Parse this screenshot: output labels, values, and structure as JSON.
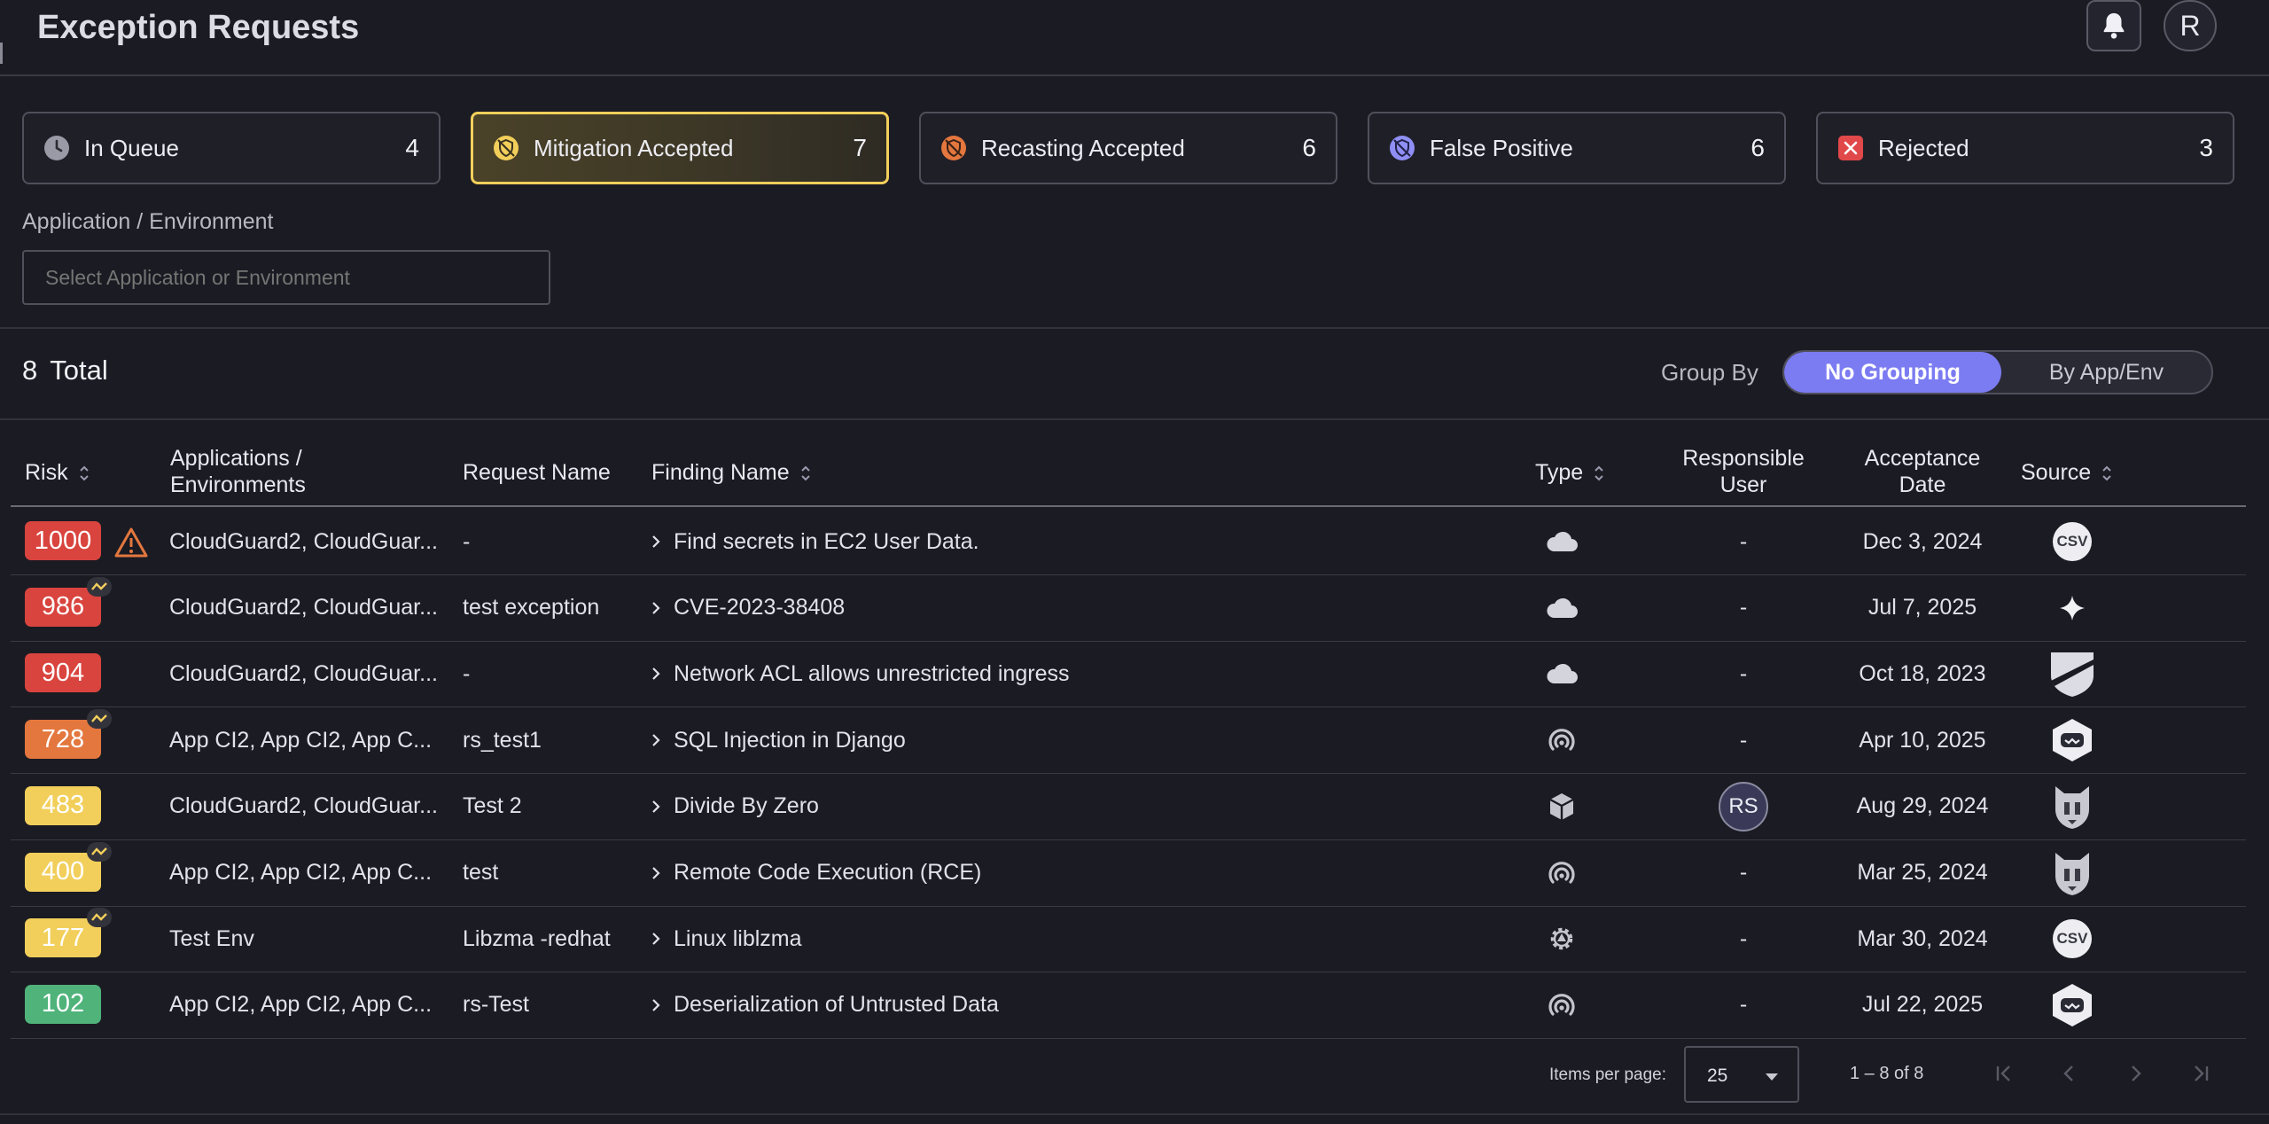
{
  "header": {
    "title": "Exception Requests",
    "avatar_letter": "R"
  },
  "status_cards": [
    {
      "label": "In Queue",
      "count": "4",
      "icon": "clock-icon"
    },
    {
      "label": "Mitigation Accepted",
      "count": "7",
      "icon": "mitigation-shield-icon"
    },
    {
      "label": "Recasting Accepted",
      "count": "6",
      "icon": "recast-shield-icon"
    },
    {
      "label": "False Positive",
      "count": "6",
      "icon": "false-positive-shield-icon"
    },
    {
      "label": "Rejected",
      "count": "3",
      "icon": "x-icon"
    }
  ],
  "filter": {
    "label": "Application / Environment",
    "placeholder": "Select Application or Environment"
  },
  "summary": {
    "count": "8",
    "label": "Total"
  },
  "group_by": {
    "label": "Group By",
    "options": [
      "No Grouping",
      "By App/Env"
    ],
    "selected": "No Grouping"
  },
  "table": {
    "headers": {
      "risk": "Risk",
      "apps_line1": "Applications /",
      "apps_line2": "Environments",
      "request": "Request Name",
      "finding": "Finding Name",
      "type": "Type",
      "user_line1": "Responsible",
      "user_line2": "User",
      "date_line1": "Acceptance",
      "date_line2": "Date",
      "source": "Source"
    },
    "rows": [
      {
        "risk": "1000",
        "risk_color": "#d9443e",
        "warning": true,
        "trend": false,
        "apps": "CloudGuard2, CloudGuar...",
        "request": "-",
        "finding": "Find secrets in EC2 User Data.",
        "type_icon": "cloud-icon",
        "user": "-",
        "date": "Dec 3, 2024",
        "source_icon": "csv-icon",
        "source_text": "CSV"
      },
      {
        "risk": "986",
        "risk_color": "#d9443e",
        "warning": false,
        "trend": true,
        "apps": "CloudGuard2, CloudGuar...",
        "request": "test exception",
        "finding": "CVE-2023-38408",
        "type_icon": "cloud-icon",
        "user": "-",
        "date": "Jul 7, 2025",
        "source_icon": "sparkle-icon",
        "source_text": ""
      },
      {
        "risk": "904",
        "risk_color": "#d9443e",
        "warning": false,
        "trend": false,
        "apps": "CloudGuard2, CloudGuar...",
        "request": "-",
        "finding": "Network ACL allows unrestricted ingress",
        "type_icon": "cloud-icon",
        "user": "-",
        "date": "Oct 18, 2023",
        "source_icon": "shield-logo-icon",
        "source_text": ""
      },
      {
        "risk": "728",
        "risk_color": "#e3773e",
        "warning": false,
        "trend": true,
        "apps": "App CI2, App CI2, App C...",
        "request": "rs_test1",
        "finding": "SQL Injection in Django",
        "type_icon": "signal-icon",
        "user": "-",
        "date": "Apr 10, 2025",
        "source_icon": "hexagon-bot-icon",
        "source_text": ""
      },
      {
        "risk": "483",
        "risk_color": "#f2cf5b",
        "warning": false,
        "trend": false,
        "apps": "CloudGuard2, CloudGuar...",
        "request": "Test 2",
        "finding": "Divide By Zero",
        "type_icon": "cube-icon",
        "user": "RS",
        "date": "Aug 29, 2024",
        "source_icon": "wolf-icon",
        "source_text": ""
      },
      {
        "risk": "400",
        "risk_color": "#f2cf5b",
        "warning": false,
        "trend": true,
        "apps": "App CI2, App CI2, App C...",
        "request": "test",
        "finding": "Remote Code Execution (RCE)",
        "type_icon": "signal-icon",
        "user": "-",
        "date": "Mar 25, 2024",
        "source_icon": "wolf-icon",
        "source_text": ""
      },
      {
        "risk": "177",
        "risk_color": "#f2cf5b",
        "warning": false,
        "trend": true,
        "apps": "Test Env",
        "request": "Libzma -redhat",
        "finding": "Linux liblzma",
        "type_icon": "gear-icon",
        "user": "-",
        "date": "Mar 30, 2024",
        "source_icon": "csv-icon",
        "source_text": "CSV"
      },
      {
        "risk": "102",
        "risk_color": "#4fb37a",
        "warning": false,
        "trend": false,
        "apps": "App CI2, App CI2, App C...",
        "request": "rs-Test",
        "finding": "Deserialization of Untrusted Data",
        "type_icon": "signal-icon",
        "user": "-",
        "date": "Jul 22, 2025",
        "source_icon": "hexagon-bot-icon",
        "source_text": ""
      }
    ]
  },
  "pagination": {
    "items_per_page_label": "Items per page:",
    "items_per_page": "25",
    "range": "1 – 8 of 8"
  }
}
